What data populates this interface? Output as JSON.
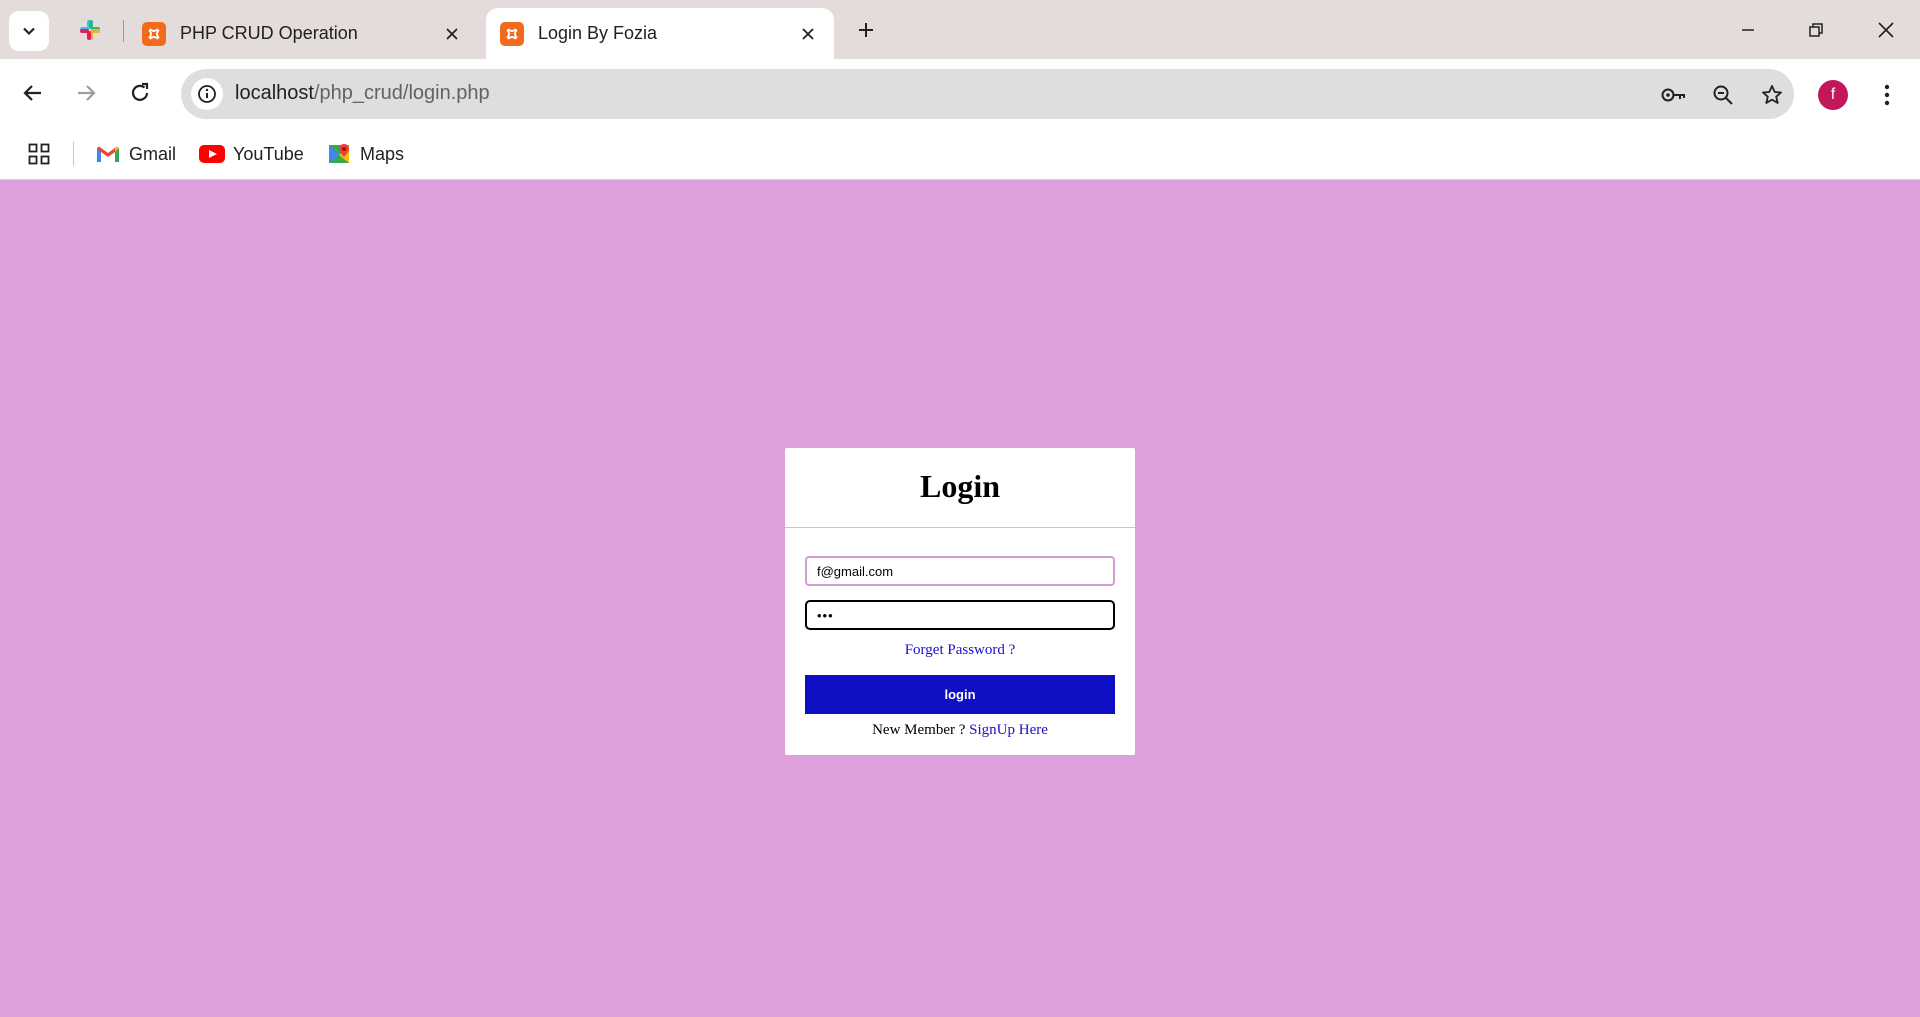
{
  "browser": {
    "tabs": [
      {
        "title": "PHP CRUD Operation",
        "active": false,
        "favicon": "xampp-icon"
      },
      {
        "title": "Login By Fozia",
        "active": true,
        "favicon": "xampp-icon"
      }
    ],
    "url": {
      "host": "localhost",
      "path": "/php_crud/login.php"
    },
    "profile_initial": "f",
    "accent_colors": {
      "profile": "#c2185b",
      "favicon": "#f26a1b"
    }
  },
  "bookmarks": [
    {
      "label": "Gmail",
      "icon": "gmail-icon"
    },
    {
      "label": "YouTube",
      "icon": "youtube-icon"
    },
    {
      "label": "Maps",
      "icon": "maps-icon"
    }
  ],
  "page": {
    "background": "#dda0dd",
    "login_form": {
      "title": "Login",
      "email_value": "f@gmail.com",
      "password_value": "•••",
      "forgot_link": "Forget Password ?",
      "submit_label": "login",
      "signup_prompt": "New Member ?",
      "signup_link": "SignUp Here",
      "button_color": "#0f0fc4",
      "link_color": "#1a0fc4"
    }
  }
}
